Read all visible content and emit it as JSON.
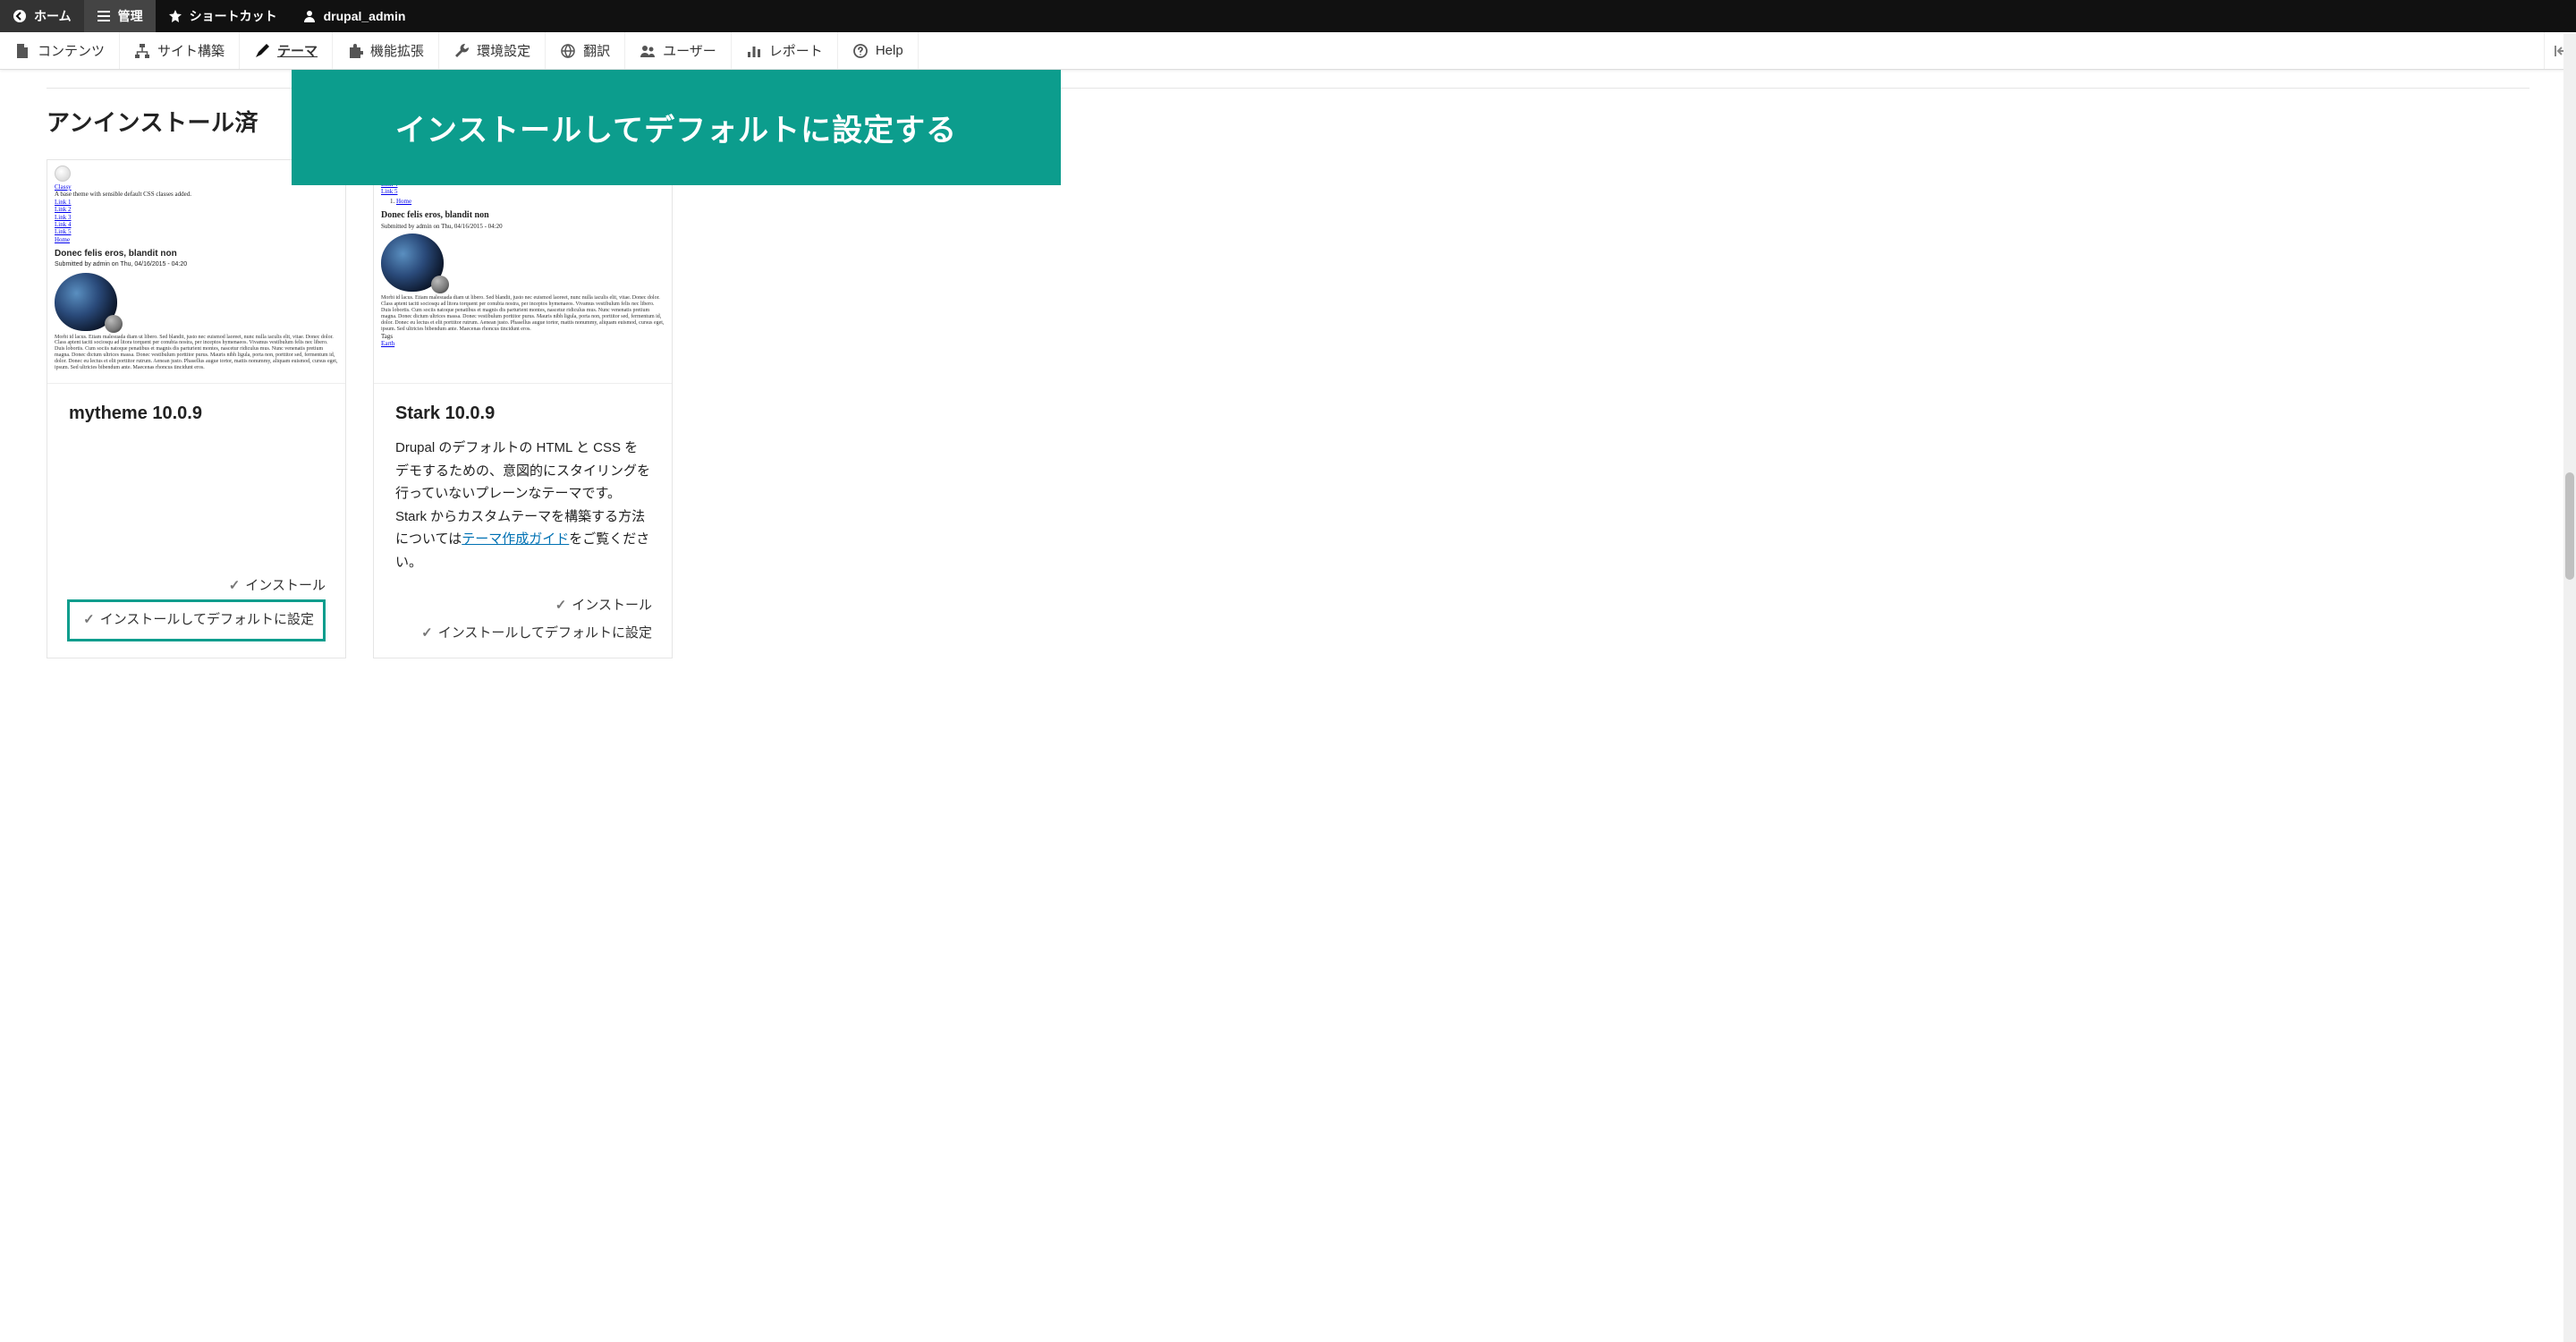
{
  "topbar": {
    "home": "ホーム",
    "manage": "管理",
    "shortcuts": "ショートカット",
    "user": "drupal_admin"
  },
  "adminmenu": {
    "content": "コンテンツ",
    "structure": "サイト構築",
    "appearance": "テーマ",
    "extend": "機能拡張",
    "config": "環境設定",
    "translate": "翻訳",
    "people": "ユーザー",
    "reports": "レポート",
    "help": "Help"
  },
  "banner": "インストールしてデフォルトに設定する",
  "section_title_truncated": "アンインストール済",
  "preview_common": {
    "links": [
      "Link 1",
      "Link 2",
      "Link 3",
      "Link 4",
      "Link 5"
    ],
    "home": "Home",
    "article_title": "Donec felis eros, blandit non",
    "submitted": "Submitted by admin on Thu, 04/16/2015 - 04:20",
    "lorem": "Morbi id lacus. Etiam malesuada diam ut libero. Sed blandit, justo nec euismod laoreet, nunc nulla iaculis elit, vitae. Donec dolor. Class aptent taciti sociosqu ad litora torquent per conubia nostra, per inceptos hymenaeos. Vivamus vestibulum felis nec libero. Duis lobortis. Cum sociis natoque penatibus et magnis dis parturient montes, nascetur ridiculus mus. Nunc venenatis pretium magna. Donec dictum ultrices massa. Donec vestibulum porttitor purus. Mauris nibh ligula, porta non, porttitor sed, fermentum id, dolor. Donec eu lectus et elit porttitor rutrum. Aenean justo. Phasellus augue tortor, mattis nonummy, aliquam euismod, cursus eget, ipsum. Sed ultricies bibendum ante. Maecenas rhoncus tincidunt eros.",
    "tags": "Tags",
    "earth": "Earth"
  },
  "preview_classy": {
    "name": "Classy",
    "desc": "A base theme with sensible default CSS classes added."
  },
  "themes": [
    {
      "title": "mytheme 10.0.9",
      "desc": "",
      "desc_link": "",
      "desc_after_link": "",
      "install": "インストール",
      "install_default": "インストールしてデフォルトに設定",
      "highlight_default": true
    },
    {
      "title": "Stark 10.0.9",
      "desc": "Drupal のデフォルトの HTML と CSS をデモするための、意図的にスタイリングを行っていないプレーンなテーマです。 Stark からカスタムテーマを構築する方法については",
      "desc_link": "テーマ作成ガイド",
      "desc_after_link": "をご覧ください。",
      "install": "インストール",
      "install_default": "インストールしてデフォルトに設定",
      "highlight_default": false
    }
  ]
}
